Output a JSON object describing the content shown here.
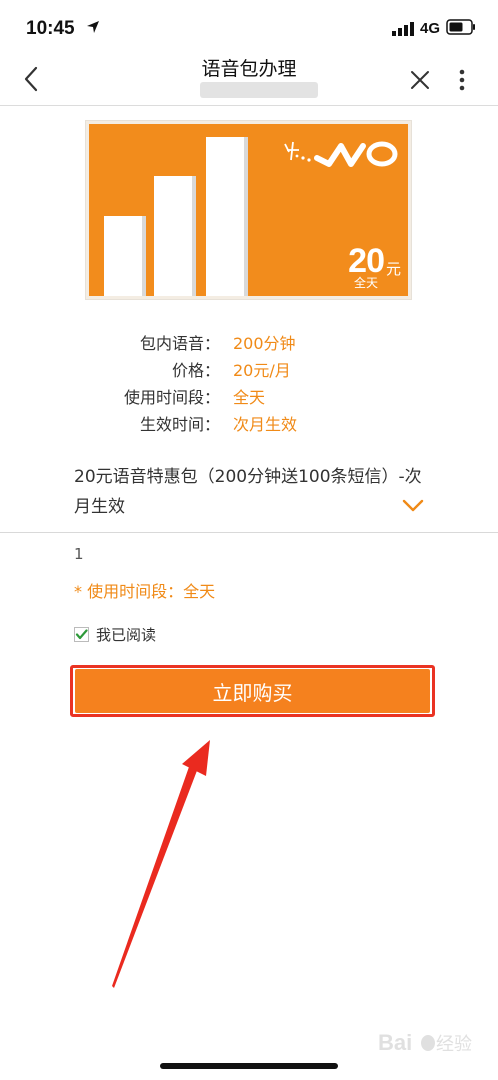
{
  "status_bar": {
    "time": "10:45",
    "network": "4G"
  },
  "nav": {
    "title": "语音包办理"
  },
  "card": {
    "price": "20",
    "price_unit": "元",
    "note": "全天"
  },
  "details": [
    {
      "label": "包内语音：",
      "value": "200分钟"
    },
    {
      "label": "价格：",
      "value": "20元/月"
    },
    {
      "label": "使用时间段：",
      "value": "全天"
    },
    {
      "label": "生效时间：",
      "value": "次月生效"
    }
  ],
  "product": {
    "selected": "20元语音特惠包（200分钟送100条短信）-次月生效"
  },
  "quantity": "1",
  "notice": "* 使用时间段：全天",
  "agreement": {
    "label": "我已阅读",
    "checked": true
  },
  "buy_button": {
    "label": "立即购买"
  },
  "colors": {
    "accent": "#f5811e",
    "highlight": "#ea3323",
    "value_text": "#f08a17"
  }
}
